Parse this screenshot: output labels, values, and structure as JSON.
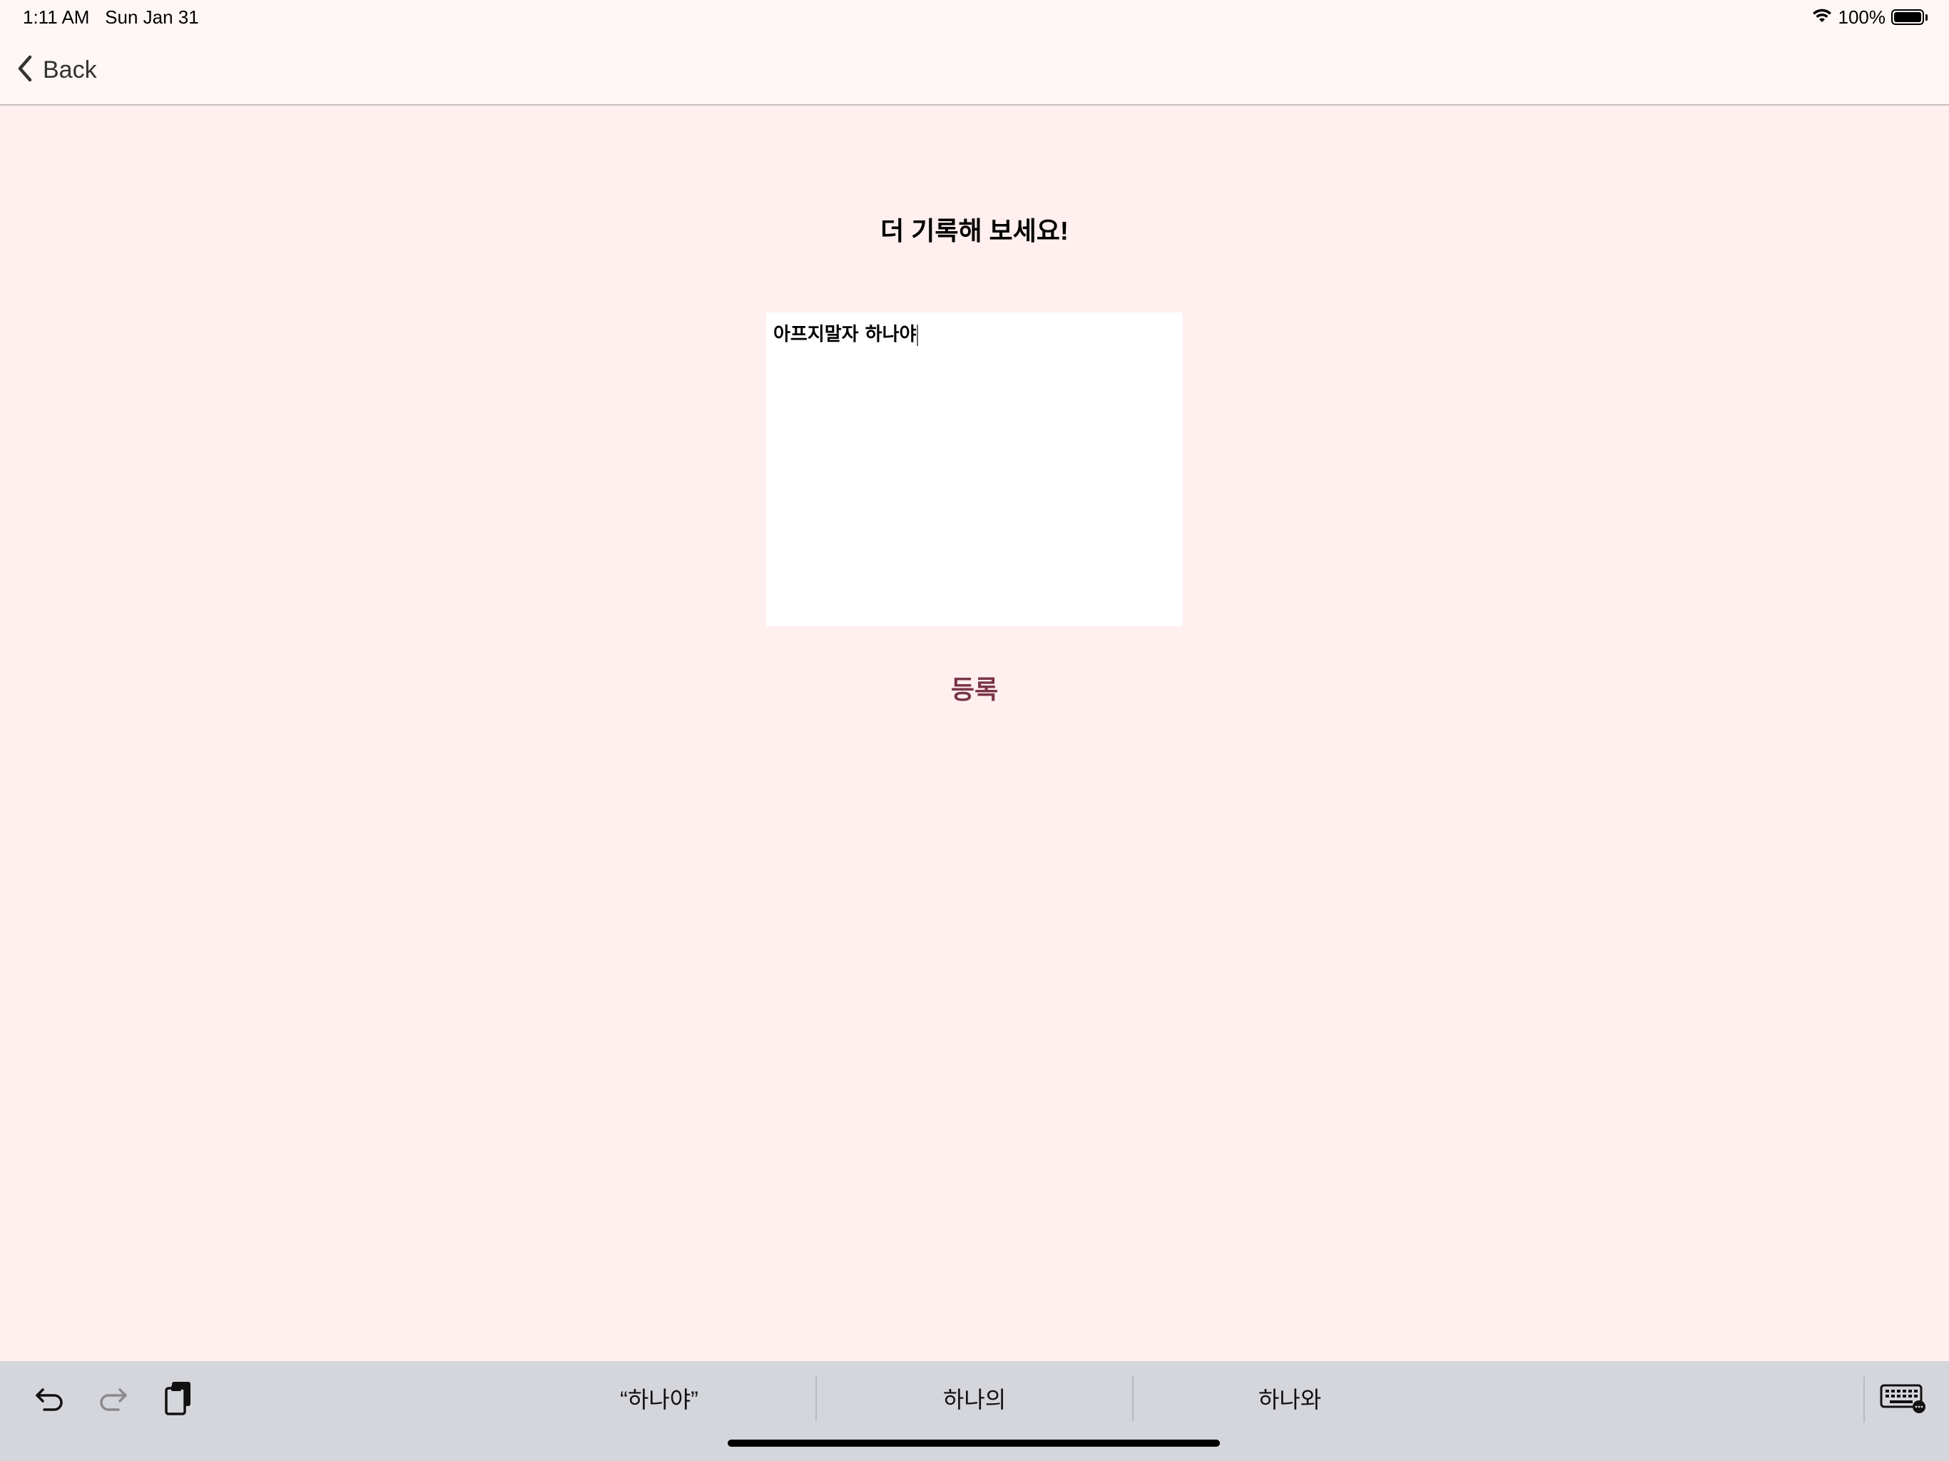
{
  "status_bar": {
    "time": "1:11 AM",
    "date": "Sun Jan 31",
    "battery_percent": "100%",
    "wifi_icon": "wifi-icon",
    "battery_icon": "battery-full-icon"
  },
  "nav": {
    "back_label": "Back",
    "back_icon": "chevron-left-icon"
  },
  "main": {
    "title": "더 기록해 보세요!",
    "memo_text": "아프지말자 하나야",
    "submit_label": "등록"
  },
  "keyboard_bar": {
    "tools": [
      "undo-icon",
      "redo-icon",
      "paste-icon"
    ],
    "suggestions": [
      "“하나야”",
      "하나의",
      "하나와"
    ],
    "keyboard_icon": "keyboard-icon"
  },
  "colors": {
    "background": "#FFEFEF",
    "nav_background": "#FFF7F5",
    "accent": "#7A3548",
    "keyboard_bar": "#D5D6DB"
  }
}
